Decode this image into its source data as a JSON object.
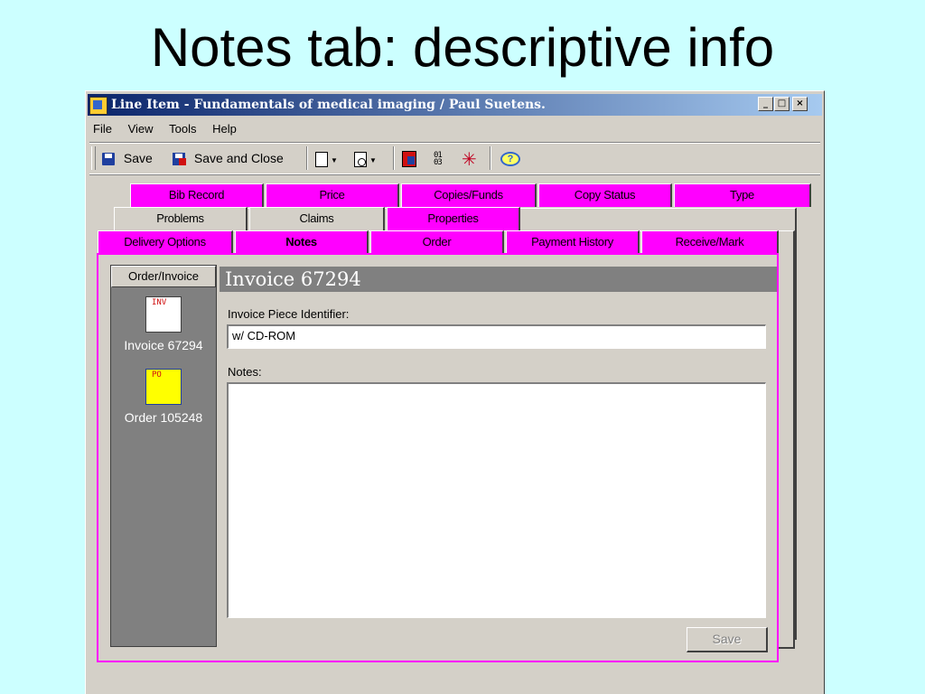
{
  "slide": {
    "title": "Notes tab: descriptive info"
  },
  "window": {
    "title": "Line Item - Fundamentals of medical imaging / Paul Suetens.",
    "buttons": {
      "minimize": "_",
      "maximize": "□",
      "close": "×"
    }
  },
  "menu": [
    "File",
    "View",
    "Tools",
    "Help"
  ],
  "toolbar": {
    "save_label": "Save",
    "save_close_label": "Save and Close"
  },
  "tabs": {
    "row1": [
      "Bib Record",
      "Price",
      "Copies/Funds",
      "Copy Status",
      "Type"
    ],
    "row2": [
      "Problems",
      "Claims",
      "Properties"
    ],
    "row3": [
      "Delivery Options",
      "Notes",
      "Order",
      "Payment History",
      "Receive/Mark"
    ],
    "active": "Notes"
  },
  "sidebar": {
    "header": "Order/Invoice",
    "items": [
      {
        "label": "Invoice 67294",
        "icon_text": "INV",
        "icon": "invoice-doc-icon"
      },
      {
        "label": "Order 105248",
        "icon_text": "PO",
        "icon": "order-doc-icon"
      }
    ]
  },
  "main": {
    "header": "Invoice 67294",
    "invoice_piece_label": "Invoice Piece Identifier:",
    "invoice_piece_value": "w/ CD-ROM",
    "notes_label": "Notes:",
    "notes_value": "",
    "save_label": "Save"
  },
  "colors": {
    "background": "#ccffff",
    "tab_magenta": "#ff00ff",
    "window_gray": "#d4d0c8",
    "titlebar_start": "#0a246a",
    "titlebar_end": "#a6caf0"
  }
}
